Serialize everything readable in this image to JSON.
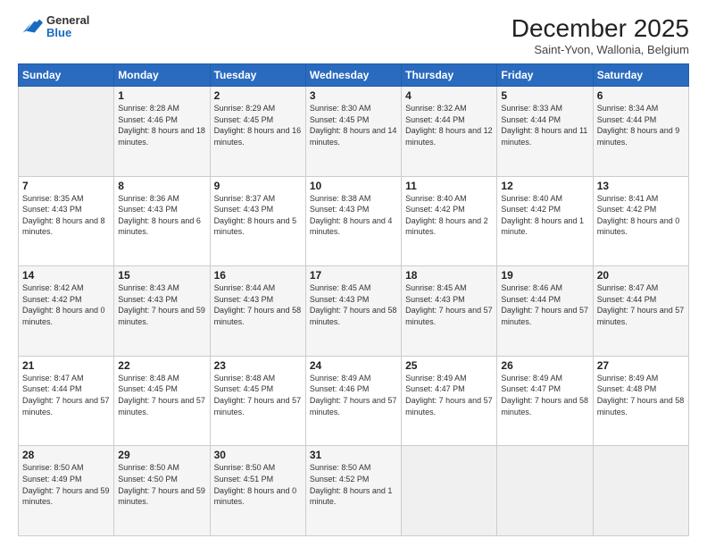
{
  "header": {
    "logo_general": "General",
    "logo_blue": "Blue",
    "month_title": "December 2025",
    "subtitle": "Saint-Yvon, Wallonia, Belgium"
  },
  "days_of_week": [
    "Sunday",
    "Monday",
    "Tuesday",
    "Wednesday",
    "Thursday",
    "Friday",
    "Saturday"
  ],
  "weeks": [
    [
      {
        "day": "",
        "sunrise": "",
        "sunset": "",
        "daylight": ""
      },
      {
        "day": "1",
        "sunrise": "Sunrise: 8:28 AM",
        "sunset": "Sunset: 4:46 PM",
        "daylight": "Daylight: 8 hours and 18 minutes."
      },
      {
        "day": "2",
        "sunrise": "Sunrise: 8:29 AM",
        "sunset": "Sunset: 4:45 PM",
        "daylight": "Daylight: 8 hours and 16 minutes."
      },
      {
        "day": "3",
        "sunrise": "Sunrise: 8:30 AM",
        "sunset": "Sunset: 4:45 PM",
        "daylight": "Daylight: 8 hours and 14 minutes."
      },
      {
        "day": "4",
        "sunrise": "Sunrise: 8:32 AM",
        "sunset": "Sunset: 4:44 PM",
        "daylight": "Daylight: 8 hours and 12 minutes."
      },
      {
        "day": "5",
        "sunrise": "Sunrise: 8:33 AM",
        "sunset": "Sunset: 4:44 PM",
        "daylight": "Daylight: 8 hours and 11 minutes."
      },
      {
        "day": "6",
        "sunrise": "Sunrise: 8:34 AM",
        "sunset": "Sunset: 4:44 PM",
        "daylight": "Daylight: 8 hours and 9 minutes."
      }
    ],
    [
      {
        "day": "7",
        "sunrise": "Sunrise: 8:35 AM",
        "sunset": "Sunset: 4:43 PM",
        "daylight": "Daylight: 8 hours and 8 minutes."
      },
      {
        "day": "8",
        "sunrise": "Sunrise: 8:36 AM",
        "sunset": "Sunset: 4:43 PM",
        "daylight": "Daylight: 8 hours and 6 minutes."
      },
      {
        "day": "9",
        "sunrise": "Sunrise: 8:37 AM",
        "sunset": "Sunset: 4:43 PM",
        "daylight": "Daylight: 8 hours and 5 minutes."
      },
      {
        "day": "10",
        "sunrise": "Sunrise: 8:38 AM",
        "sunset": "Sunset: 4:43 PM",
        "daylight": "Daylight: 8 hours and 4 minutes."
      },
      {
        "day": "11",
        "sunrise": "Sunrise: 8:40 AM",
        "sunset": "Sunset: 4:42 PM",
        "daylight": "Daylight: 8 hours and 2 minutes."
      },
      {
        "day": "12",
        "sunrise": "Sunrise: 8:40 AM",
        "sunset": "Sunset: 4:42 PM",
        "daylight": "Daylight: 8 hours and 1 minute."
      },
      {
        "day": "13",
        "sunrise": "Sunrise: 8:41 AM",
        "sunset": "Sunset: 4:42 PM",
        "daylight": "Daylight: 8 hours and 0 minutes."
      }
    ],
    [
      {
        "day": "14",
        "sunrise": "Sunrise: 8:42 AM",
        "sunset": "Sunset: 4:42 PM",
        "daylight": "Daylight: 8 hours and 0 minutes."
      },
      {
        "day": "15",
        "sunrise": "Sunrise: 8:43 AM",
        "sunset": "Sunset: 4:43 PM",
        "daylight": "Daylight: 7 hours and 59 minutes."
      },
      {
        "day": "16",
        "sunrise": "Sunrise: 8:44 AM",
        "sunset": "Sunset: 4:43 PM",
        "daylight": "Daylight: 7 hours and 58 minutes."
      },
      {
        "day": "17",
        "sunrise": "Sunrise: 8:45 AM",
        "sunset": "Sunset: 4:43 PM",
        "daylight": "Daylight: 7 hours and 58 minutes."
      },
      {
        "day": "18",
        "sunrise": "Sunrise: 8:45 AM",
        "sunset": "Sunset: 4:43 PM",
        "daylight": "Daylight: 7 hours and 57 minutes."
      },
      {
        "day": "19",
        "sunrise": "Sunrise: 8:46 AM",
        "sunset": "Sunset: 4:44 PM",
        "daylight": "Daylight: 7 hours and 57 minutes."
      },
      {
        "day": "20",
        "sunrise": "Sunrise: 8:47 AM",
        "sunset": "Sunset: 4:44 PM",
        "daylight": "Daylight: 7 hours and 57 minutes."
      }
    ],
    [
      {
        "day": "21",
        "sunrise": "Sunrise: 8:47 AM",
        "sunset": "Sunset: 4:44 PM",
        "daylight": "Daylight: 7 hours and 57 minutes."
      },
      {
        "day": "22",
        "sunrise": "Sunrise: 8:48 AM",
        "sunset": "Sunset: 4:45 PM",
        "daylight": "Daylight: 7 hours and 57 minutes."
      },
      {
        "day": "23",
        "sunrise": "Sunrise: 8:48 AM",
        "sunset": "Sunset: 4:45 PM",
        "daylight": "Daylight: 7 hours and 57 minutes."
      },
      {
        "day": "24",
        "sunrise": "Sunrise: 8:49 AM",
        "sunset": "Sunset: 4:46 PM",
        "daylight": "Daylight: 7 hours and 57 minutes."
      },
      {
        "day": "25",
        "sunrise": "Sunrise: 8:49 AM",
        "sunset": "Sunset: 4:47 PM",
        "daylight": "Daylight: 7 hours and 57 minutes."
      },
      {
        "day": "26",
        "sunrise": "Sunrise: 8:49 AM",
        "sunset": "Sunset: 4:47 PM",
        "daylight": "Daylight: 7 hours and 58 minutes."
      },
      {
        "day": "27",
        "sunrise": "Sunrise: 8:49 AM",
        "sunset": "Sunset: 4:48 PM",
        "daylight": "Daylight: 7 hours and 58 minutes."
      }
    ],
    [
      {
        "day": "28",
        "sunrise": "Sunrise: 8:50 AM",
        "sunset": "Sunset: 4:49 PM",
        "daylight": "Daylight: 7 hours and 59 minutes."
      },
      {
        "day": "29",
        "sunrise": "Sunrise: 8:50 AM",
        "sunset": "Sunset: 4:50 PM",
        "daylight": "Daylight: 7 hours and 59 minutes."
      },
      {
        "day": "30",
        "sunrise": "Sunrise: 8:50 AM",
        "sunset": "Sunset: 4:51 PM",
        "daylight": "Daylight: 8 hours and 0 minutes."
      },
      {
        "day": "31",
        "sunrise": "Sunrise: 8:50 AM",
        "sunset": "Sunset: 4:52 PM",
        "daylight": "Daylight: 8 hours and 1 minute."
      },
      {
        "day": "",
        "sunrise": "",
        "sunset": "",
        "daylight": ""
      },
      {
        "day": "",
        "sunrise": "",
        "sunset": "",
        "daylight": ""
      },
      {
        "day": "",
        "sunrise": "",
        "sunset": "",
        "daylight": ""
      }
    ]
  ]
}
